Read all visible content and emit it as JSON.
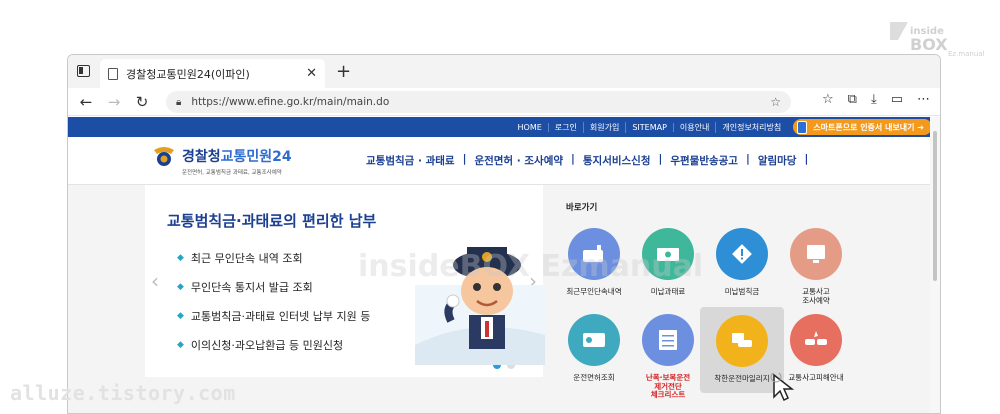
{
  "browser": {
    "tab_title": "경찰청교통민원24(이파인)",
    "tab_close": "✕",
    "new_tab": "+",
    "url": "https://www.efine.go.kr/main/main.do",
    "back": "←",
    "forward": "→",
    "refresh": "↻"
  },
  "topbar": {
    "links": [
      "HOME",
      "로그인",
      "회원가입",
      "SITEMAP",
      "이용안내",
      "개인정보처리방침"
    ],
    "smart_button": "스마트폰으로 인증서 내보내기 ➜"
  },
  "header": {
    "logo_prefix": "경찰청",
    "logo_main": "교통민원24",
    "logo_sub": "운전면허, 교통범칙금 과태료, 교통조사예약",
    "menu": [
      "교통범칙금 · 과태료",
      "운전면허 · 조사예약",
      "통지서비스신청",
      "우편물반송공고",
      "알림마당"
    ]
  },
  "banner": {
    "title": "교통범칙금·과태료의 편리한 납부",
    "items": [
      "최근 무인단속 내역 조회",
      "무인단속 통지서 발급 조회",
      "교통범칙금·과태료 인터넷 납부 지원 등",
      "이의신청·과오납환급 등 민원신청"
    ],
    "prev_arrow": "‹",
    "next_arrow": "›"
  },
  "quick": {
    "title": "바로가기",
    "items": [
      {
        "label": "최근무인단속내역",
        "color": "#6c8fe0"
      },
      {
        "label": "미납과태료",
        "color": "#3fb79a"
      },
      {
        "label": "미납범칙금",
        "color": "#2e8fd6"
      },
      {
        "label": "교통사고\n조사예약",
        "color": "#e59c86"
      },
      {
        "label": "운전면허조회",
        "color": "#3fa9bf"
      },
      {
        "label": "난폭·보복운전\n제거전단\n체크리스트",
        "color": "#6c8fe0"
      },
      {
        "label": "착한운전마일리지",
        "color": "#f2b21b"
      },
      {
        "label": "교통사고피해안내",
        "color": "#e66f5f"
      }
    ]
  },
  "watermarks": {
    "blog": "alluze.tistory.com",
    "center": "insideBOX Ezmanual",
    "corner_top": "inside",
    "corner_box": "BOX",
    "corner_sub": "Ez.manual"
  }
}
